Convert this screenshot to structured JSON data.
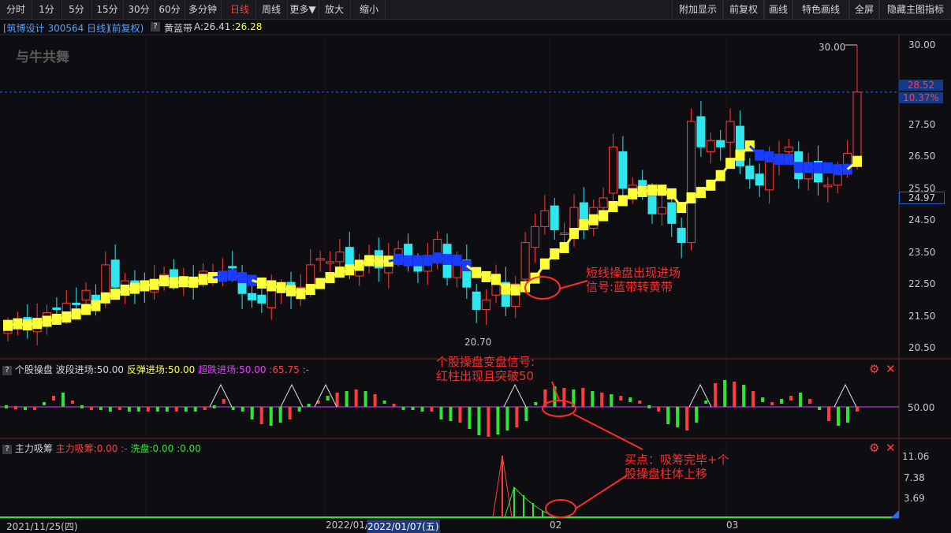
{
  "toolbar": {
    "left_buttons": [
      "分时",
      "1分",
      "5分",
      "15分",
      "30分",
      "60分",
      "多分钟",
      "日线",
      "周线",
      "更多▼",
      "放大",
      "缩小"
    ],
    "active": "日线",
    "right_buttons": [
      "附加显示",
      "前复权",
      "画线",
      "特色画线",
      "全屏",
      "隐藏主图指标"
    ]
  },
  "header": {
    "stock": "[筑博设计 300564 日线]",
    "adjust": "(前复权)",
    "q": "?",
    "indicator_name": "黄蓝带",
    "a_value": "A:26.41",
    "b_value": ":26.28"
  },
  "logo_text": "与牛共舞",
  "price_axis": {
    "ticks": [
      "30.00",
      "27.50",
      "26.50",
      "25.50",
      "24.50",
      "23.50",
      "22.50",
      "21.50",
      "20.50"
    ],
    "current_price": "28.52",
    "current_pct": "10.37%",
    "crosshair_price": "24.97",
    "high_label": "30.00",
    "low_label": "20.70"
  },
  "annotations": {
    "main": [
      "短线操盘出现进场",
      "信号:蓝带转黄带"
    ],
    "mid": [
      "个股操盘变盘信号:",
      "红柱出现且突破50"
    ],
    "bottom": [
      "买点：吸筹完毕+个",
      "股操盘柱体上移"
    ]
  },
  "panel1": {
    "q": "?",
    "title": "个股操盘",
    "s1": "波段进场:50.00",
    "s2": "反弹进场:50.00",
    "s3": "超跌进场:50.00",
    "s4": ":65.75",
    "s5": ":-",
    "axis_value": "50.00"
  },
  "panel2": {
    "q": "?",
    "title": "主力吸筹",
    "s1": "主力吸筹:0.00",
    "s2": ":-",
    "s3": "洗盘:0.00",
    "s4": ":0.00",
    "axis_values": [
      "11.06",
      "7.38",
      "3.69"
    ]
  },
  "xaxis": {
    "labels": [
      "2021/11/25(四)",
      "2022/01/",
      "2022/01/07(五)",
      "02",
      "03"
    ]
  },
  "colors": {
    "up": "#ff3b3b",
    "down": "#2ee6ee",
    "yellow_band": "#ffff3a",
    "blue_band": "#1a3cff",
    "accent_red": "#ff2a2a"
  },
  "icons": [
    "gear-icon",
    "close-icon"
  ]
}
